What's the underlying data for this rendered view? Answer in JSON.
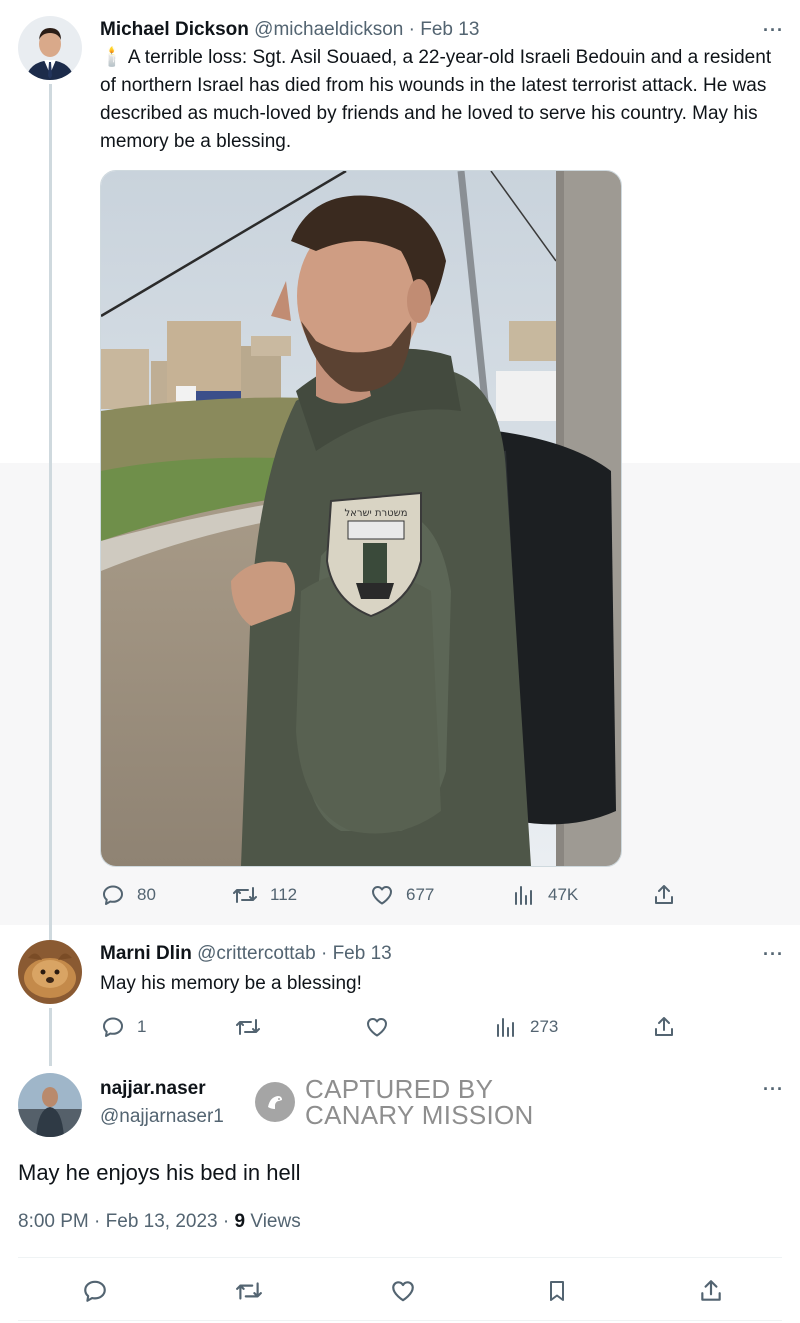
{
  "tweet1": {
    "name": "Michael Dickson",
    "handle": "@michaeldickson",
    "sep": "·",
    "date": "Feb 13",
    "text": "🕯️ A terrible loss: Sgt. Asil Souaed, a 22-year-old Israeli Bedouin and a resident of northern Israel has died from his wounds in the latest terrorist attack. He was described as much-loved by friends and he loved to serve his country. May his memory be a blessing.",
    "more": "···",
    "metrics": {
      "replies": "80",
      "retweets": "112",
      "likes": "677",
      "views": "47K"
    },
    "photo_badge_text": "משטרת ישראל"
  },
  "tweet2": {
    "name": "Marni Dlin",
    "handle": "@crittercottab",
    "sep": "·",
    "date": "Feb 13",
    "text": "May his memory be a blessing!",
    "more": "···",
    "metrics": {
      "replies": "1",
      "views": "273"
    }
  },
  "tweet3": {
    "name": "najjar.naser",
    "handle": "@najjarnaser1",
    "text": "May he enjoys his bed in hell",
    "more": "···",
    "timestamp": "8:00 PM · Feb 13, 2023 · ",
    "views_count": "9",
    "views_label": " Views"
  },
  "watermark": {
    "line1": "CAPTURED BY",
    "line2": "CANARY MISSION"
  },
  "colors": {
    "text": "#0f1419",
    "muted": "#536471",
    "thread": "#cfd9de"
  }
}
